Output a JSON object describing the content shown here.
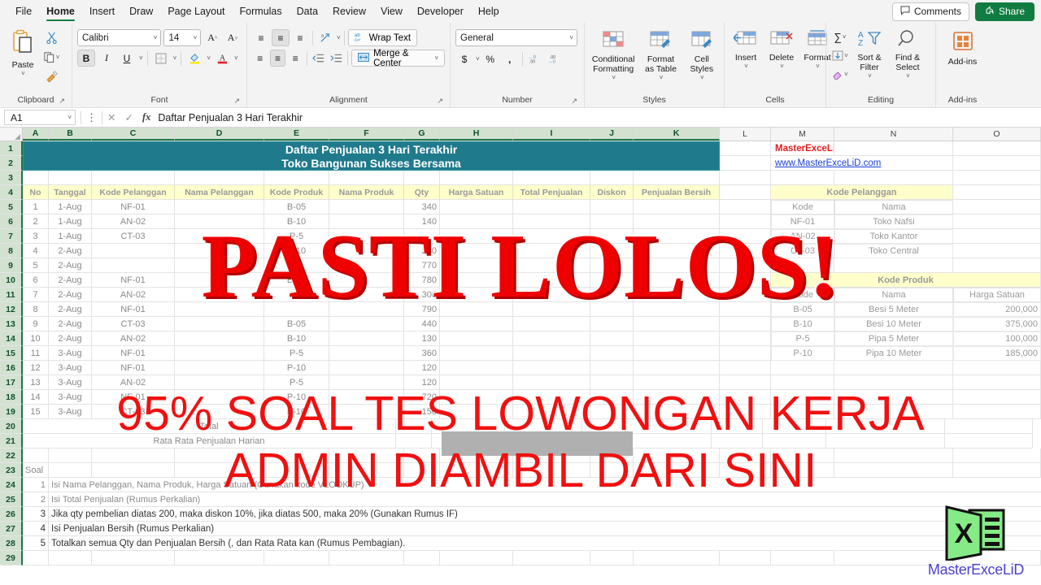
{
  "menu": {
    "items": [
      "File",
      "Home",
      "Insert",
      "Draw",
      "Page Layout",
      "Formulas",
      "Data",
      "Review",
      "View",
      "Developer",
      "Help"
    ],
    "active": "Home",
    "comments_label": "Comments",
    "share_label": "Share"
  },
  "ribbon": {
    "groups": [
      {
        "label": "Clipboard",
        "paste_label": "Paste"
      },
      {
        "label": "Font"
      },
      {
        "label": "Alignment",
        "wrap_label": "Wrap Text",
        "merge_label": "Merge & Center"
      },
      {
        "label": "Number"
      },
      {
        "label": "Styles"
      },
      {
        "label": "Cells"
      },
      {
        "label": "Editing"
      },
      {
        "label": "Add-ins"
      }
    ],
    "font_name": "Calibri",
    "font_size": "14",
    "number_format": "General",
    "styles_buttons": [
      "Conditional Formatting",
      "Format as Table",
      "Cell Styles"
    ],
    "cells_buttons": [
      "Insert",
      "Delete",
      "Format"
    ],
    "editing_buttons": [
      "Sort & Filter",
      "Find & Select"
    ],
    "addins_button": "Add-ins"
  },
  "formula_bar": {
    "name_box": "A1",
    "formula": "Daftar Penjualan 3 Hari Terakhir"
  },
  "grid": {
    "columns": [
      "A",
      "B",
      "C",
      "D",
      "E",
      "F",
      "G",
      "H",
      "I",
      "J",
      "K",
      "L",
      "M",
      "N",
      "O"
    ],
    "row_numbers": [
      "1",
      "2",
      "3",
      "4",
      "5",
      "6",
      "7",
      "8",
      "9",
      "10",
      "11",
      "12",
      "13",
      "14",
      "15",
      "16",
      "17",
      "18",
      "19",
      "20",
      "21",
      "22",
      "23",
      "24",
      "25",
      "26",
      "27",
      "28",
      "29"
    ],
    "banner_line1": "Daftar Penjualan 3 Hari Terakhir",
    "banner_line2": "Toko Bangunan Sukses Bersama",
    "table_headers": [
      "No",
      "Tanggal",
      "Kode Pelanggan",
      "Nama Pelanggan",
      "Kode Produk",
      "Nama Produk",
      "Qty",
      "Harga Satuan",
      "Total Penjualan",
      "Diskon",
      "Penjualan Bersih"
    ],
    "rows": [
      {
        "no": "1",
        "tanggal": "1-Aug",
        "kode_pelanggan": "NF-01",
        "nama_pelanggan": "",
        "kode_produk": "B-05",
        "nama_produk": "",
        "qty": "340",
        "harga": "",
        "total": "",
        "diskon": "",
        "bersih": ""
      },
      {
        "no": "2",
        "tanggal": "1-Aug",
        "kode_pelanggan": "AN-02",
        "nama_pelanggan": "",
        "kode_produk": "B-10",
        "nama_produk": "",
        "qty": "140",
        "harga": "",
        "total": "",
        "diskon": "",
        "bersih": ""
      },
      {
        "no": "3",
        "tanggal": "1-Aug",
        "kode_pelanggan": "CT-03",
        "nama_pelanggan": "",
        "kode_produk": "P-5",
        "nama_produk": "",
        "qty": "",
        "harga": "",
        "total": "",
        "diskon": "",
        "bersih": ""
      },
      {
        "no": "4",
        "tanggal": "2-Aug",
        "kode_pelanggan": "",
        "nama_pelanggan": "",
        "kode_produk": "P-10",
        "nama_produk": "",
        "qty": "230",
        "harga": "",
        "total": "",
        "diskon": "",
        "bersih": ""
      },
      {
        "no": "5",
        "tanggal": "2-Aug",
        "kode_pelanggan": "",
        "nama_pelanggan": "",
        "kode_produk": "",
        "nama_produk": "",
        "qty": "770",
        "harga": "",
        "total": "",
        "diskon": "",
        "bersih": ""
      },
      {
        "no": "6",
        "tanggal": "2-Aug",
        "kode_pelanggan": "NF-01",
        "nama_pelanggan": "",
        "kode_produk": "B-10",
        "nama_produk": "",
        "qty": "780",
        "harga": "",
        "total": "",
        "diskon": "",
        "bersih": ""
      },
      {
        "no": "7",
        "tanggal": "2-Aug",
        "kode_pelanggan": "AN-02",
        "nama_pelanggan": "",
        "kode_produk": "P-5",
        "nama_produk": "",
        "qty": "300",
        "harga": "",
        "total": "",
        "diskon": "",
        "bersih": ""
      },
      {
        "no": "8",
        "tanggal": "2-Aug",
        "kode_pelanggan": "NF-01",
        "nama_pelanggan": "",
        "kode_produk": "",
        "nama_produk": "",
        "qty": "790",
        "harga": "",
        "total": "",
        "diskon": "",
        "bersih": ""
      },
      {
        "no": "9",
        "tanggal": "2-Aug",
        "kode_pelanggan": "CT-03",
        "nama_pelanggan": "",
        "kode_produk": "B-05",
        "nama_produk": "",
        "qty": "440",
        "harga": "",
        "total": "",
        "diskon": "",
        "bersih": ""
      },
      {
        "no": "10",
        "tanggal": "2-Aug",
        "kode_pelanggan": "AN-02",
        "nama_pelanggan": "",
        "kode_produk": "B-10",
        "nama_produk": "",
        "qty": "130",
        "harga": "",
        "total": "",
        "diskon": "",
        "bersih": ""
      },
      {
        "no": "11",
        "tanggal": "3-Aug",
        "kode_pelanggan": "NF-01",
        "nama_pelanggan": "",
        "kode_produk": "P-5",
        "nama_produk": "",
        "qty": "360",
        "harga": "",
        "total": "",
        "diskon": "",
        "bersih": ""
      },
      {
        "no": "12",
        "tanggal": "3-Aug",
        "kode_pelanggan": "NF-01",
        "nama_pelanggan": "",
        "kode_produk": "P-10",
        "nama_produk": "",
        "qty": "120",
        "harga": "",
        "total": "",
        "diskon": "",
        "bersih": ""
      },
      {
        "no": "13",
        "tanggal": "3-Aug",
        "kode_pelanggan": "AN-02",
        "nama_pelanggan": "",
        "kode_produk": "P-5",
        "nama_produk": "",
        "qty": "120",
        "harga": "",
        "total": "",
        "diskon": "",
        "bersih": ""
      },
      {
        "no": "14",
        "tanggal": "3-Aug",
        "kode_pelanggan": "NF-01",
        "nama_pelanggan": "",
        "kode_produk": "P-10",
        "nama_produk": "",
        "qty": "720",
        "harga": "",
        "total": "",
        "diskon": "",
        "bersih": ""
      },
      {
        "no": "15",
        "tanggal": "3-Aug",
        "kode_pelanggan": "CT-03",
        "nama_pelanggan": "",
        "kode_produk": "P-10",
        "nama_produk": "",
        "qty": "150",
        "harga": "",
        "total": "",
        "diskon": "",
        "bersih": ""
      }
    ],
    "total_label": "Total",
    "average_label": "Rata Rata Penjualan Harian",
    "soal_label": "Soal",
    "soal_items": [
      {
        "no": "1",
        "text": "Isi Nama Pelanggan, Nama Produk, Harga Satuan (Gunakan kode VLOOKUP)"
      },
      {
        "no": "2",
        "text": "Isi Total Penjualan (Rumus Perkalian)"
      },
      {
        "no": "3",
        "text": "Jika qty pembelian diatas 200, maka diskon 10%, jika diatas 500, maka 20% (Gunakan Rumus IF)"
      },
      {
        "no": "4",
        "text": "Isi Penjualan Bersih (Rumus Perkalian)"
      },
      {
        "no": "5",
        "text": "Totalkan semua Qty dan Penjualan Bersih (, dan Rata Rata kan (Rumus Pembagian)."
      }
    ]
  },
  "side_panel": {
    "brand": "MasterExceLiD",
    "website": "www.MasterExceLiD.com",
    "customer_table": {
      "title": "Kode Pelanggan",
      "headers": [
        "Kode",
        "Nama"
      ],
      "rows": [
        {
          "kode": "NF-01",
          "nama": "Toko Nafsi"
        },
        {
          "kode": "AN-02",
          "nama": "Toko Kantor"
        },
        {
          "kode": "CT-03",
          "nama": "Toko Central"
        }
      ]
    },
    "product_table": {
      "title": "Kode Produk",
      "headers": [
        "Kode",
        "Nama",
        "Harga Satuan"
      ],
      "rows": [
        {
          "kode": "B-05",
          "nama": "Besi 5 Meter",
          "harga": "200,000"
        },
        {
          "kode": "B-10",
          "nama": "Besi 10 Meter",
          "harga": "375,000"
        },
        {
          "kode": "P-5",
          "nama": "Pipa 5 Meter",
          "harga": "100,000"
        },
        {
          "kode": "P-10",
          "nama": "Pipa 10 Meter",
          "harga": "185,000"
        }
      ]
    }
  },
  "overlay": {
    "headline": "PASTI LOLOS!",
    "line2": "95% SOAL TES LOWONGAN KERJA",
    "line3": "ADMIN DIAMBIL DARI SINI"
  },
  "logo": {
    "text": "MasterExceLiD",
    "mark_letter": "X"
  },
  "colors": {
    "accent_green": "#107c41",
    "banner_teal": "#1f7a8c",
    "overlay_red": "#ee0000",
    "header_yellow": "#ffffcc",
    "logo_blue": "#4a3fd0",
    "logo_green": "#7ee37e"
  }
}
